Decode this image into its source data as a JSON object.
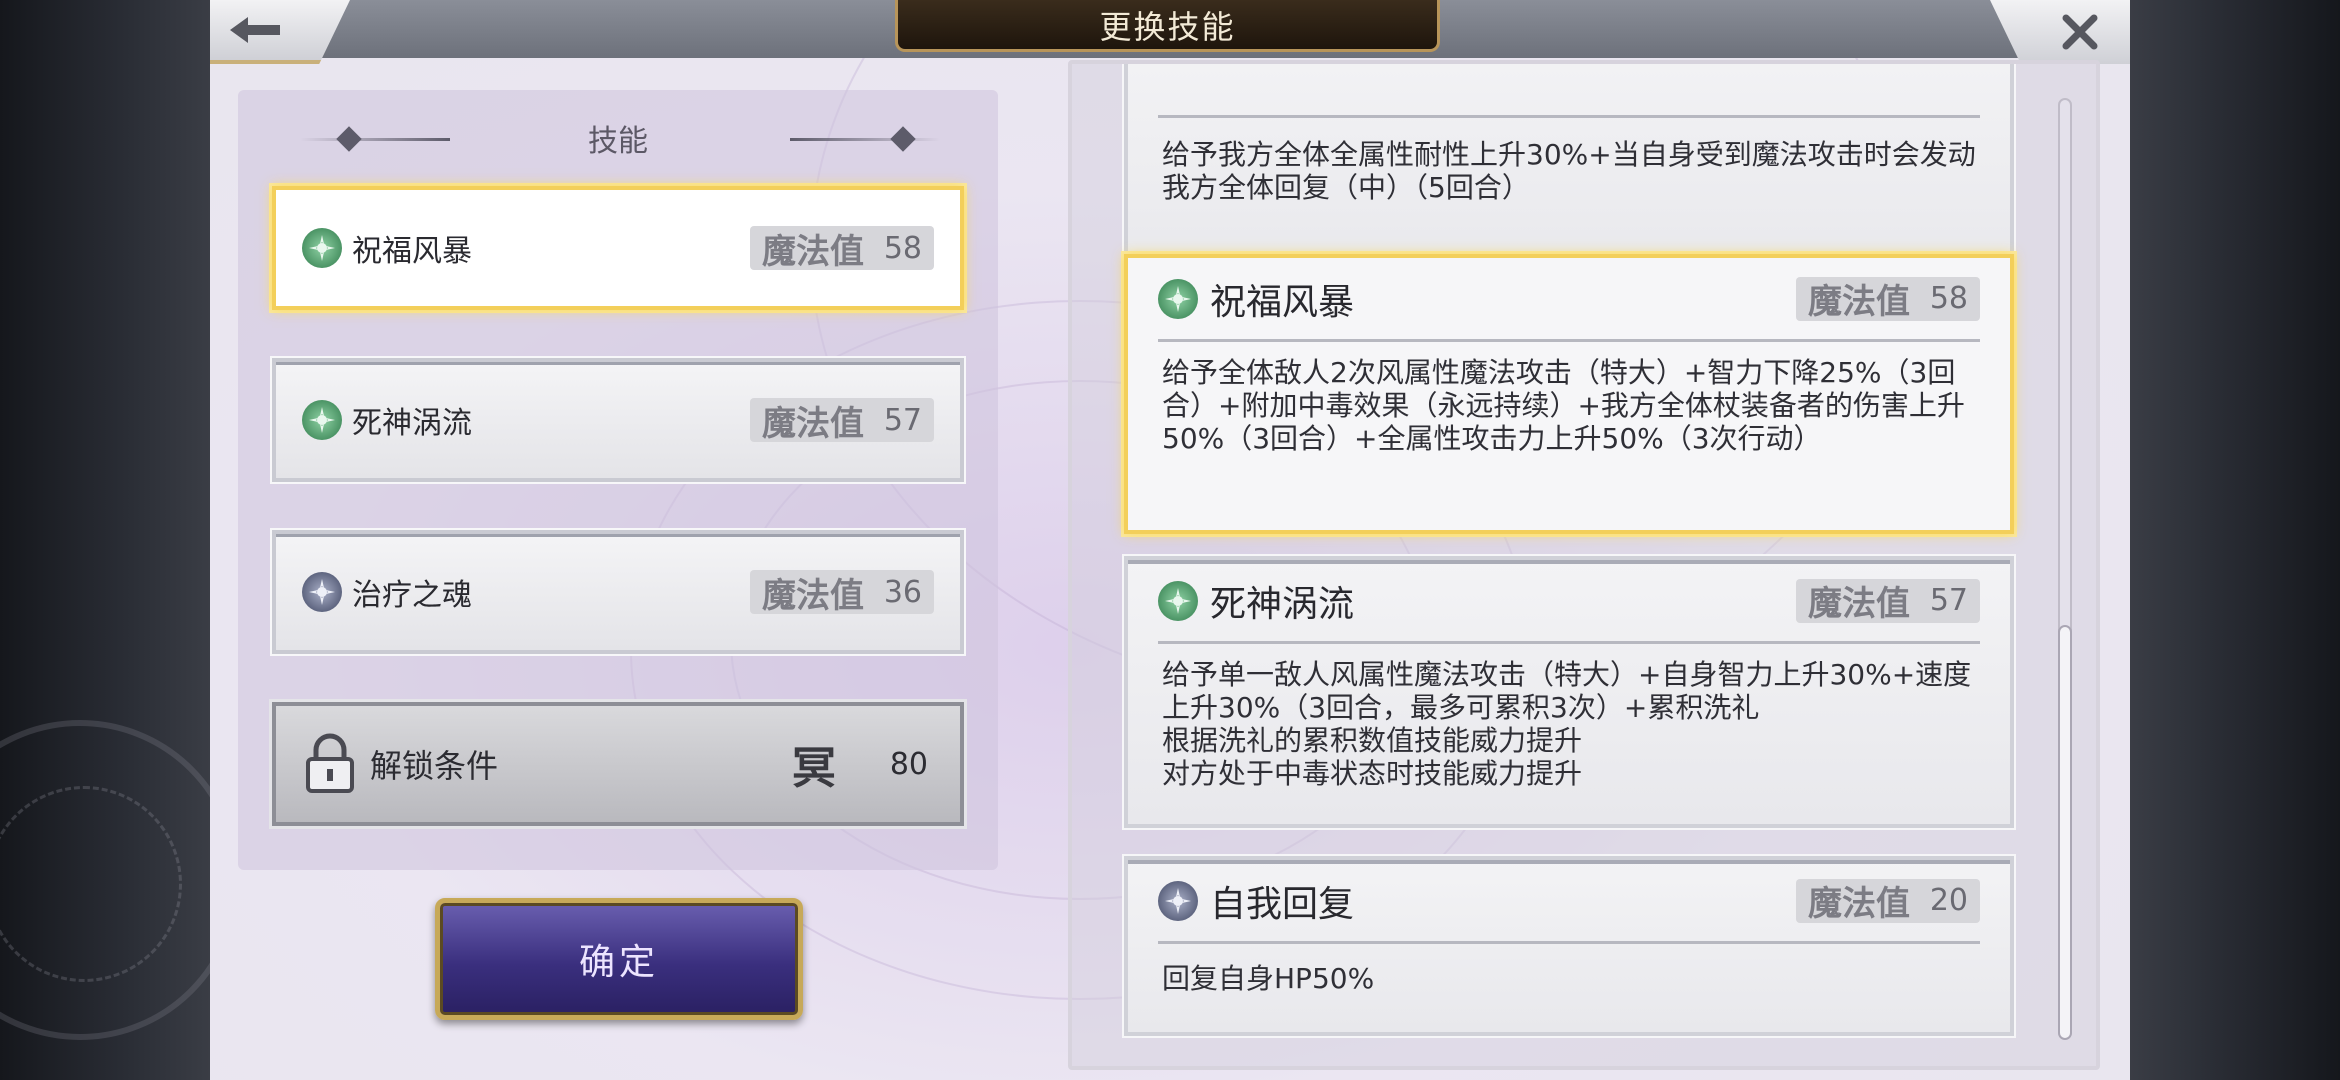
{
  "header": {
    "title": "更换技能"
  },
  "left": {
    "heading": "技能",
    "skills": [
      {
        "name": "祝福风暴",
        "mp_label": "魔法值",
        "mp": "58",
        "icon": "wind-icon"
      },
      {
        "name": "死神涡流",
        "mp_label": "魔法值",
        "mp": "57",
        "icon": "wind-icon"
      },
      {
        "name": "治疗之魂",
        "mp_label": "魔法值",
        "mp": "36",
        "icon": "holy-icon"
      }
    ],
    "lock": {
      "label": "解锁条件",
      "kanji": "冥",
      "value": "80"
    },
    "confirm": "确定"
  },
  "right": {
    "cards": [
      {
        "desc": "给予我方全体全属性耐性上升30%+当自身受到魔法攻击时会发动我方全体回复（中）（5回合）"
      },
      {
        "name": "祝福风暴",
        "mp_label": "魔法值",
        "mp": "58",
        "icon": "wind-icon",
        "desc": "给予全体敌人2次风属性魔法攻击（特大）+智力下降25%（3回合）+附加中毒效果（永远持续）+我方全体杖装备者的伤害上升50%（3回合）+全属性攻击力上升50%（3次行动）"
      },
      {
        "name": "死神涡流",
        "mp_label": "魔法值",
        "mp": "57",
        "icon": "wind-icon",
        "desc1": "给予单一敌人风属性魔法攻击（特大）+自身智力上升30%+速度上升30%（3回合，最多可累积3次）+累积洗礼",
        "desc2": "根据洗礼的累积数值技能威力提升",
        "desc3": "对方处于中毒状态时技能威力提升"
      },
      {
        "name": "自我回复",
        "mp_label": "魔法值",
        "mp": "20",
        "icon": "holy-icon",
        "desc": "回复自身HP50%"
      }
    ]
  },
  "colors": {
    "selected_border": "#f3cf5a",
    "confirm_bg": "#3a2f7e",
    "title_plate": "#1e150c"
  }
}
